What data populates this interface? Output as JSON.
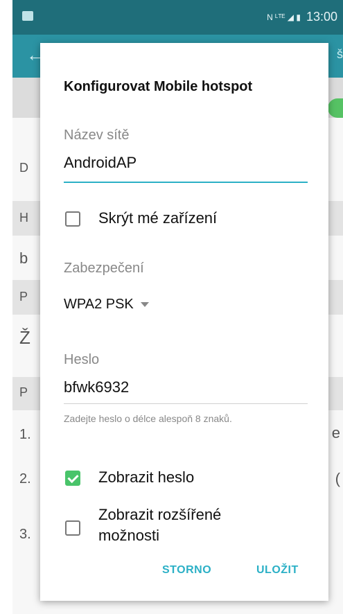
{
  "status": {
    "time": "13:00",
    "icons": "N ᴸᵀᴱ ◢ ▮"
  },
  "background": {
    "back": "←",
    "title_fragment": "š",
    "row_chars": [
      "D",
      "H",
      "b",
      "P",
      "Ž",
      "P",
      "1.",
      "2.",
      "3."
    ],
    "right_chars": [
      "e",
      "("
    ]
  },
  "dialog": {
    "title": "Konfigurovat Mobile hotspot",
    "network_name_label": "Název sítě",
    "network_name_value": "AndroidAP",
    "hide_device_label": "Skrýt mé zařízení",
    "hide_device_checked": false,
    "security_label": "Zabezpečení",
    "security_value": "WPA2 PSK",
    "password_label": "Heslo",
    "password_value": "bfwk6932",
    "password_hint": "Zadejte heslo o délce alespoň 8 znaků.",
    "show_password_label": "Zobrazit heslo",
    "show_password_checked": true,
    "advanced_label": "Zobrazit rozšířené možnosti",
    "advanced_checked": false,
    "cancel_button": "STORNO",
    "save_button": "ULOŽIT",
    "accent_color": "#2bb0c6",
    "check_color": "#49c46a"
  }
}
